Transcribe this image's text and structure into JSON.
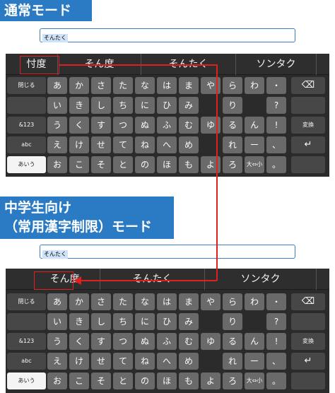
{
  "normal_mode": {
    "title": "通常モード",
    "input_text": "そんたく",
    "candidates": [
      "忖度",
      "そん度",
      "そんたく",
      "ソンタク"
    ]
  },
  "student_mode": {
    "title_line1": "中学生向け",
    "title_line2": "（常用漢字制限）モード",
    "input_text": "そんたく",
    "candidates": [
      "そん度",
      "そんたく",
      "ソンタク"
    ]
  },
  "keyboard": {
    "left_keys": [
      "閉じる",
      "",
      "&123",
      "abc",
      "あいう"
    ],
    "right_keys": [
      "⌫",
      "",
      "変換",
      "↵",
      ""
    ],
    "rows": [
      [
        "あ",
        "か",
        "さ",
        "た",
        "な",
        "は",
        "ま",
        "や",
        "ら",
        "わ",
        "・"
      ],
      [
        "い",
        "き",
        "し",
        "ち",
        "に",
        "ひ",
        "み",
        "",
        "り",
        "",
        "?"
      ],
      [
        "う",
        "く",
        "す",
        "つ",
        "ぬ",
        "ふ",
        "む",
        "ゆ",
        "る",
        "ん",
        "!"
      ],
      [
        "え",
        "け",
        "せ",
        "て",
        "ね",
        "へ",
        "め",
        "",
        "れ",
        "ー",
        "、"
      ],
      [
        "お",
        "こ",
        "そ",
        "と",
        "の",
        "ほ",
        "も",
        "よ",
        "ろ",
        "大⇔小",
        "。"
      ]
    ]
  },
  "colors": {
    "banner": "#2b7bc4",
    "keyboard_bg": "#2b2b2b",
    "key": "#6a6a6a",
    "annotation": "#e02020"
  }
}
